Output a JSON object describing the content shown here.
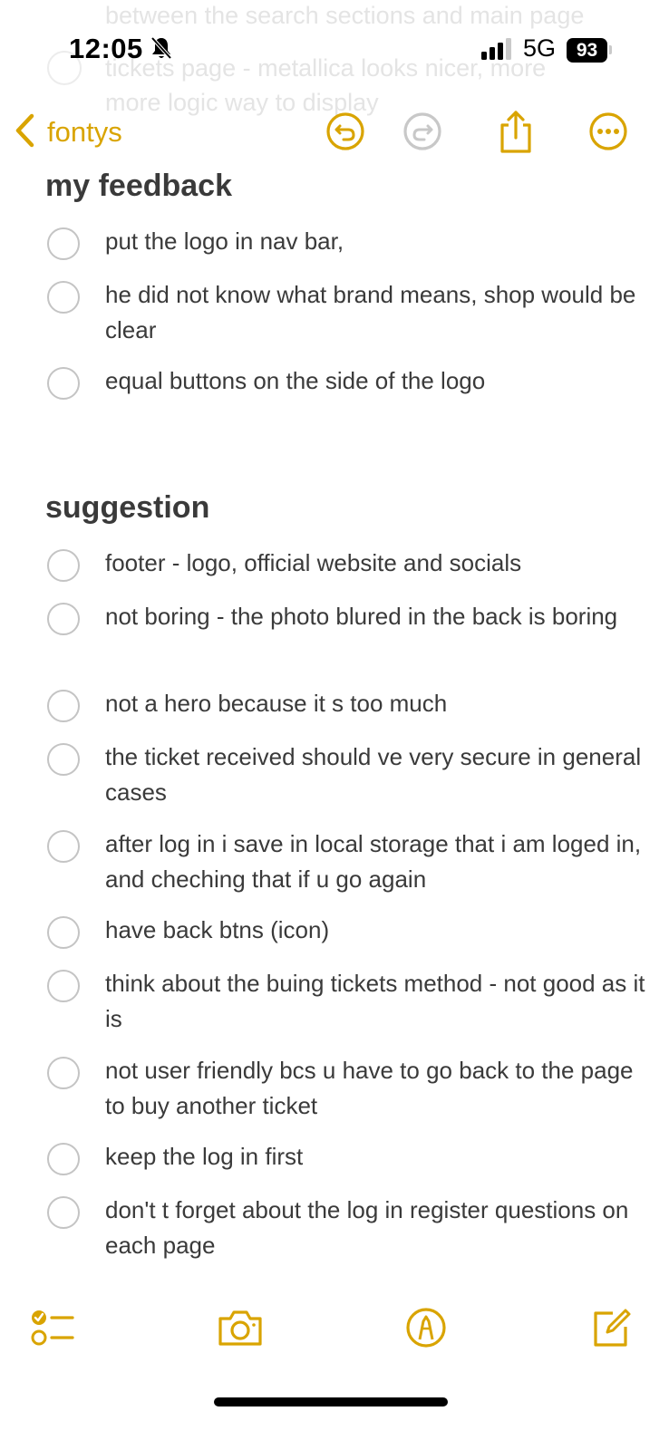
{
  "background_text": [
    "between the search sections and main page",
    "tickets page - metallica looks nicer, more",
    "more logic way to display"
  ],
  "status_bar": {
    "time": "12:05",
    "network": "5G",
    "battery": "93"
  },
  "nav": {
    "back_label": "fontys",
    "accent_color": "#d9a400"
  },
  "sections": [
    {
      "title": "my feedback",
      "items": [
        {
          "text": "put the logo in nav bar,",
          "checked": false
        },
        {
          "text": "he did not know what brand means, shop would be clear",
          "checked": false
        },
        {
          "text": "equal buttons on the side of the logo",
          "checked": false
        }
      ]
    },
    {
      "title": "suggestion",
      "items": [
        {
          "text": "footer - logo, official website and socials",
          "checked": false
        },
        {
          "text": "not boring - the photo blured in the back is boring",
          "checked": false
        },
        {
          "text": "not a hero because it s too much",
          "checked": false
        },
        {
          "text": "the ticket received should ve very secure in general cases",
          "checked": false
        },
        {
          "text": "after log in i save in local storage that i am loged in, and cheching that if u go again",
          "checked": false
        },
        {
          "text": "have back btns (icon)",
          "checked": false
        },
        {
          "text": "think about the buing tickets method - not good as it is",
          "checked": false
        },
        {
          "text": "not user friendly bcs u have to go back to the page to buy another ticket",
          "checked": false
        },
        {
          "text": "keep the log in first",
          "checked": false
        },
        {
          "text": "don't t forget about the log in register questions on each page",
          "checked": false
        }
      ]
    }
  ],
  "toolbar_icons": [
    "checklist-icon",
    "camera-icon",
    "markup-icon",
    "compose-icon"
  ]
}
